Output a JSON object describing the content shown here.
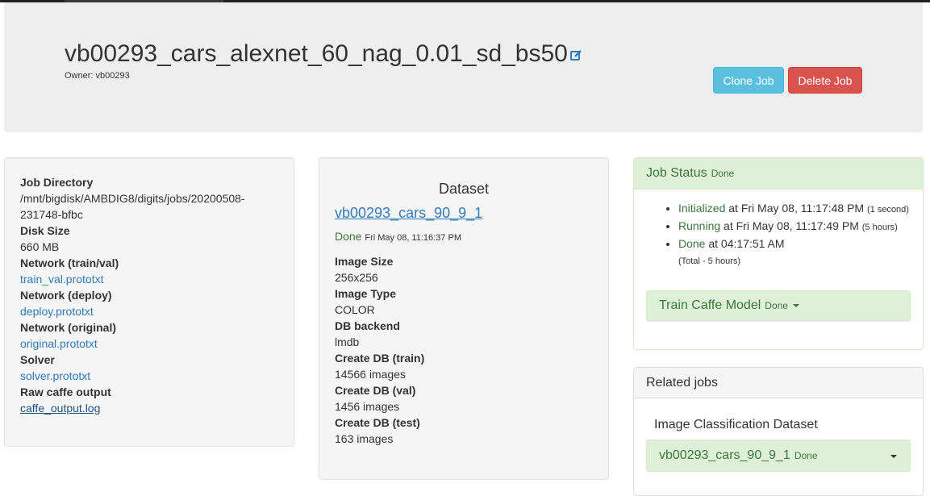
{
  "header": {
    "job_title": "vb00293_cars_alexnet_60_nag_0.01_sd_bs50",
    "owner": "Owner: vb00293",
    "clone_label": "Clone Job",
    "delete_label": "Delete Job"
  },
  "job_info": {
    "job_directory_label": "Job Directory",
    "job_directory_line1": "/mnt/bigdisk/AMBDIG8/digits/jobs/20200508-",
    "job_directory_line2": "231748-bfbc",
    "disk_size_label": "Disk Size",
    "disk_size": "660 MB",
    "network_trainval_label": "Network (train/val)",
    "network_trainval": "train_val.prototxt",
    "network_deploy_label": "Network (deploy)",
    "network_deploy": "deploy.prototxt",
    "network_original_label": "Network (original)",
    "network_original": "original.prototxt",
    "solver_label": "Solver",
    "solver": "solver.prototxt",
    "raw_output_label": "Raw caffe output",
    "raw_output": "caffe_output.log"
  },
  "dataset": {
    "heading": "Dataset",
    "name": "vb00293_cars_90_9_1",
    "status": "Done",
    "status_time": "Fri May 08, 11:16:37 PM",
    "image_size_label": "Image Size",
    "image_size": "256x256",
    "image_type_label": "Image Type",
    "image_type": "COLOR",
    "db_backend_label": "DB backend",
    "db_backend": "lmdb",
    "create_train_label": "Create DB (train)",
    "create_train": "14566 images",
    "create_val_label": "Create DB (val)",
    "create_val": "1456 images",
    "create_test_label": "Create DB (test)",
    "create_test": "163 images"
  },
  "job_status": {
    "title": "Job Status",
    "state": "Done",
    "items": [
      {
        "status": "Initialized",
        "text": " at Fri May 08, 11:17:48 PM ",
        "duration": "(1 second)"
      },
      {
        "status": "Running",
        "text": " at Fri May 08, 11:17:49 PM ",
        "duration": "(5 hours)"
      },
      {
        "status": "Done",
        "text": " at 04:17:51 AM",
        "duration": "(Total - 5 hours)"
      }
    ],
    "train_label": "Train Caffe Model",
    "train_state": "Done"
  },
  "related": {
    "title": "Related jobs",
    "subtitle": "Image Classification Dataset",
    "job_name": "vb00293_cars_90_9_1",
    "job_state": "Done"
  },
  "colors": {
    "clone_button": "#5bc0de",
    "delete_button": "#d9534f",
    "success_text": "#3c763d",
    "success_bg": "#dff0d8",
    "link": "#337ab7"
  }
}
